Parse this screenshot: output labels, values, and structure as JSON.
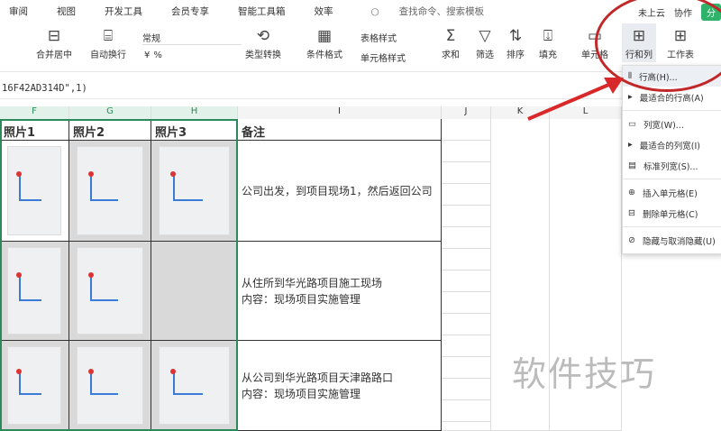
{
  "menu": [
    "审阅",
    "视图",
    "开发工具",
    "会员专享",
    "智能工具箱",
    "效率"
  ],
  "search_placeholder": "查找命令、搜索模板",
  "top_right": {
    "cloud": "未上云",
    "collab": "协作",
    "share": "分"
  },
  "ribbon": {
    "merge": "合并居中",
    "wrap": "自动换行",
    "number_format": "常规",
    "convert": "类型转换",
    "cond_format": "条件格式",
    "table_style": "表格样式",
    "cell_style": "单元格样式",
    "sum": "求和",
    "filter": "筛选",
    "sort": "排序",
    "fill": "填充",
    "cell": "单元格",
    "rowcol": "行和列",
    "sheet": "工作表",
    "currency": "¥",
    "percent": "%"
  },
  "formula": "16F42AD314D\",1)",
  "columns": [
    "F",
    "G",
    "H",
    "I",
    "J",
    "K",
    "L"
  ],
  "headers": [
    "照片1",
    "照片2",
    "照片3",
    "备注"
  ],
  "notes": [
    [
      "公司出发，到项目现场1，然后返回公司"
    ],
    [
      "从住所到华光路项目施工现场",
      "内容：现场项目实施管理"
    ],
    [
      "从公司到华光路项目天津路路口",
      "内容：现场项目实施管理"
    ]
  ],
  "dropdown": [
    "行高(H)...",
    "最适合的行高(A)",
    "列宽(W)...",
    "最适合的列宽(I)",
    "标准列宽(S)...",
    "插入单元格(E)",
    "删除单元格(C)",
    "隐藏与取消隐藏(U)"
  ],
  "watermark": "软件技巧",
  "colors": {
    "accent": "#2a8a5a",
    "annotation": "#c0282a"
  }
}
